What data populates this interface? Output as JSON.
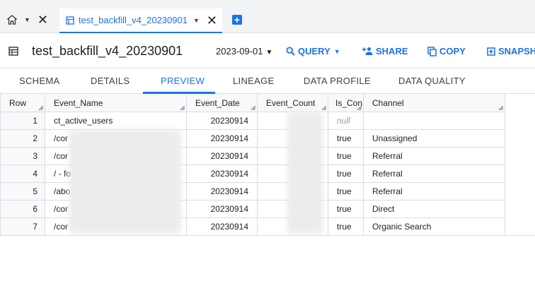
{
  "tabs": {
    "active_title": "test_backfill_v4_20230901"
  },
  "header": {
    "title": "test_backfill_v4_20230901",
    "date": "2023-09-01",
    "actions": {
      "query": "QUERY",
      "share": "SHARE",
      "copy": "COPY",
      "snapshot": "SNAPSH"
    }
  },
  "subtabs": {
    "schema": "SCHEMA",
    "details": "DETAILS",
    "preview": "PREVIEW",
    "lineage": "LINEAGE",
    "data_profile": "DATA PROFILE",
    "data_quality": "DATA QUALITY"
  },
  "table": {
    "columns": [
      "Row",
      "Event_Name",
      "Event_Date",
      "Event_Count",
      "Is_Con",
      "Channel"
    ],
    "rows": [
      {
        "row": "1",
        "name": "ct_active_users",
        "date": "20230914",
        "conv": "null",
        "channel": ""
      },
      {
        "row": "2",
        "name": "/cor",
        "date": "20230914",
        "conv": "true",
        "channel": "Unassigned"
      },
      {
        "row": "3",
        "name": "/cor",
        "date": "20230914",
        "conv": "true",
        "channel": "Referral"
      },
      {
        "row": "4",
        "name": "/ - fo",
        "date": "20230914",
        "conv": "true",
        "channel": "Referral"
      },
      {
        "row": "5",
        "name": "/abo",
        "date": "20230914",
        "conv": "true",
        "channel": "Referral"
      },
      {
        "row": "6",
        "name": "/cor",
        "date": "20230914",
        "conv": "true",
        "channel": "Direct"
      },
      {
        "row": "7",
        "name": "/cor",
        "date": "20230914",
        "conv": "true",
        "channel": "Organic Search"
      }
    ]
  },
  "colors": {
    "accent": "#1a73e8",
    "border": "#dadce0",
    "header_bg": "#f8f9fa"
  }
}
